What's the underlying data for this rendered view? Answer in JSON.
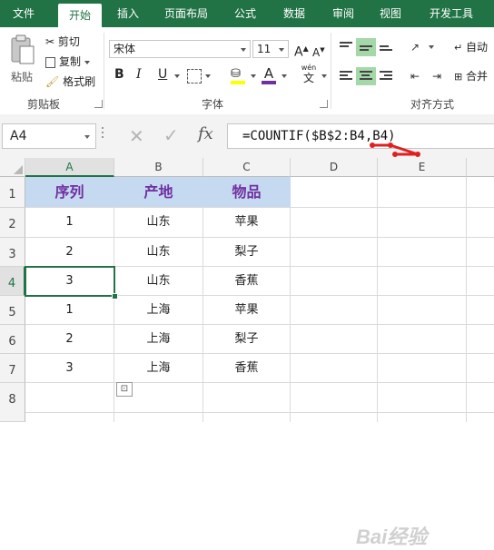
{
  "tabs": [
    "文件",
    "开始",
    "插入",
    "页面布局",
    "公式",
    "数据",
    "审阅",
    "视图",
    "开发工具"
  ],
  "active_tab": "开始",
  "ribbon": {
    "clipboard": {
      "paste": "粘贴",
      "cut": "剪切",
      "copy": "复制",
      "format_painter": "格式刷",
      "group_label": "剪贴板"
    },
    "font": {
      "font_name": "宋体",
      "font_size": "11",
      "grow_font": "A",
      "shrink_font": "A",
      "bold": "B",
      "italic": "I",
      "underline": "U",
      "font_color_glyph": "A",
      "wen_glyph": "wén",
      "wen_char": "文",
      "group_label": "字体"
    },
    "alignment": {
      "wrap_text": "自动",
      "merge": "合并",
      "group_label": "对齐方式"
    }
  },
  "formula_bar": {
    "name_box": "A4",
    "cancel_glyph": "✕",
    "enter_glyph": "✓",
    "fx_glyph": "fx",
    "formula": "=COUNTIF($B$2:B4,B4)"
  },
  "sheet": {
    "columns": [
      "A",
      "B",
      "C",
      "D",
      "E"
    ],
    "row_numbers": [
      "1",
      "2",
      "3",
      "4",
      "5",
      "6",
      "7",
      "8"
    ],
    "header": [
      "序列",
      "产地",
      "物品"
    ],
    "rows": [
      [
        "1",
        "山东",
        "苹果"
      ],
      [
        "2",
        "山东",
        "梨子"
      ],
      [
        "3",
        "山东",
        "香蕉"
      ],
      [
        "1",
        "上海",
        "苹果"
      ],
      [
        "2",
        "上海",
        "梨子"
      ],
      [
        "3",
        "上海",
        "香蕉"
      ]
    ],
    "active_cell": "A4"
  },
  "colors": {
    "accent": "#217346",
    "header_fill": "#c5d9f1",
    "header_text": "#7030a0",
    "annotation": "#e02020"
  },
  "watermark": "Bai经验"
}
